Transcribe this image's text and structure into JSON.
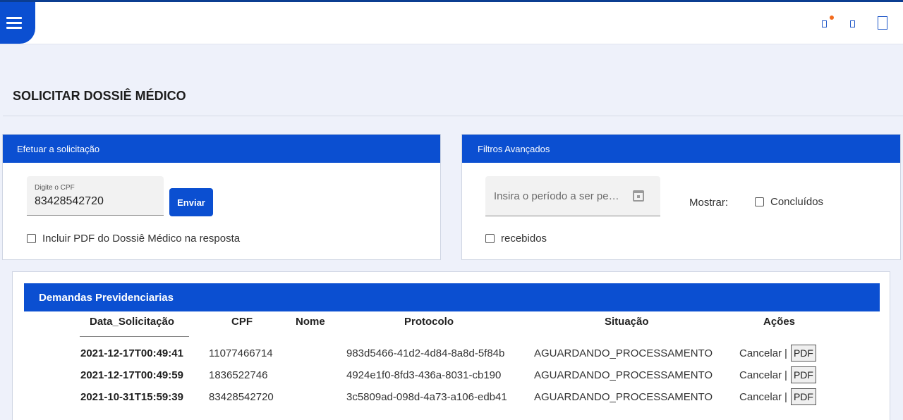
{
  "colors": {
    "primary": "#0b4fd1",
    "background": "#eef1fa",
    "notification": "#f26b1d"
  },
  "appbar": {
    "menu_icon": "hamburger-menu-icon",
    "icons": [
      "notification-icon",
      "small-square-icon",
      "tablet-icon"
    ]
  },
  "page": {
    "title": "SOLICITAR DOSSIÊ MÉDICO"
  },
  "request_card": {
    "header": "Efetuar a solicitação",
    "cpf_label": "Digite o CPF",
    "cpf_value": "83428542720",
    "submit_label": "Enviar",
    "include_pdf_label": "Incluir PDF do Dossiê Médico na resposta",
    "include_pdf_checked": false
  },
  "filters_card": {
    "header": "Filtros Avançados",
    "period_placeholder": "Insira o período a ser pe…",
    "show_label": "Mostrar:",
    "concluidos_label": "Concluídos",
    "concluidos_checked": false,
    "recebidos_label": "recebidos",
    "recebidos_checked": false
  },
  "demands": {
    "header": "Demandas Previdenciarias",
    "columns": [
      "Data_Solicitação",
      "CPF",
      "Nome",
      "Protocolo",
      "Situação",
      "Ações"
    ],
    "rows": [
      {
        "date": "2021-12-17T00:49:41",
        "cpf": "11077466714",
        "name": "",
        "protocol": "983d5466-41d2-4d84-8a8d-5f84b",
        "status": "AGUARDANDO_PROCESSAMENTO",
        "cancel": "Cancelar",
        "sep": "|",
        "pdf": "PDF"
      },
      {
        "date": "2021-12-17T00:49:59",
        "cpf": "1836522746",
        "name": "",
        "protocol": "4924e1f0-8fd3-436a-8031-cb190",
        "status": "AGUARDANDO_PROCESSAMENTO",
        "cancel": "Cancelar",
        "sep": "|",
        "pdf": "PDF"
      },
      {
        "date": "2021-10-31T15:59:39",
        "cpf": "83428542720",
        "name": "",
        "protocol": "3c5809ad-098d-4a73-a106-edb41",
        "status": "AGUARDANDO_PROCESSAMENTO",
        "cancel": "Cancelar",
        "sep": "|",
        "pdf": "PDF"
      }
    ]
  }
}
